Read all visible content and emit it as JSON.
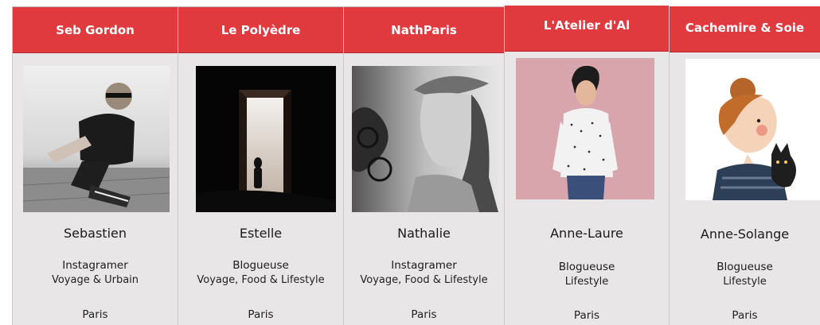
{
  "profiles": [
    {
      "brand": "Seb Gordon",
      "name": "Sebastien",
      "role": "Instagramer",
      "topics": "Voyage & Urbain",
      "city": "Paris"
    },
    {
      "brand": "Le Polyèdre",
      "name": "Estelle",
      "role": "Blogueuse",
      "topics": "Voyage, Food & Lifestyle",
      "city": "Paris"
    },
    {
      "brand": "NathParis",
      "name": "Nathalie",
      "role": "Instagramer",
      "topics": "Voyage, Food & Lifestyle",
      "city": "Paris"
    },
    {
      "brand": "L'Atelier d'Al",
      "name": "Anne-Laure",
      "role": "Blogueuse",
      "topics": "Lifestyle",
      "city": "Paris"
    },
    {
      "brand": "Cachemire & Soie",
      "name": "Anne-Solange",
      "role": "Blogueuse",
      "topics": "Lifestyle",
      "city": "Paris"
    }
  ],
  "colors": {
    "header": "#e03a3e",
    "panel": "#e8e6e7",
    "text": "#1a1a1a"
  }
}
